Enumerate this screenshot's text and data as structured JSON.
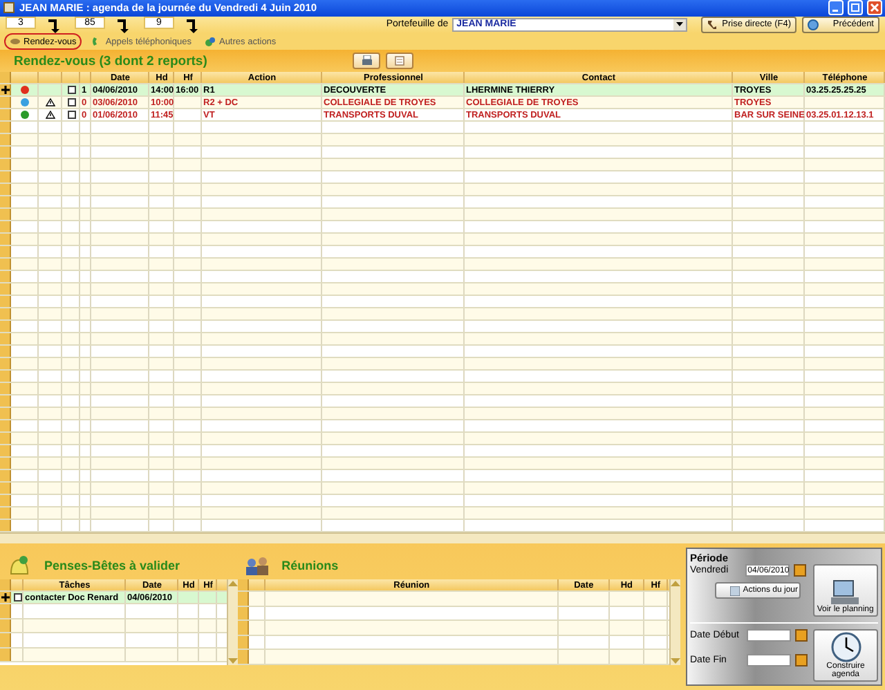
{
  "window": {
    "title": "JEAN MARIE : agenda de la journée du Vendredi 4 Juin 2010"
  },
  "counters": [
    {
      "value": "3"
    },
    {
      "value": "85"
    },
    {
      "value": "9"
    }
  ],
  "tabs": [
    {
      "label": "Rendez-vous",
      "selected": true
    },
    {
      "label": "Appels téléphoniques",
      "selected": false
    },
    {
      "label": "Autres actions",
      "selected": false
    }
  ],
  "portfolio": {
    "label": "Portefeuille de",
    "value": "JEAN MARIE"
  },
  "buttons": [
    {
      "kind": "direct",
      "label": "Prise directe (F4)"
    },
    {
      "kind": "back",
      "label": "Précédent"
    }
  ],
  "appointments": {
    "title": "Rendez-vous (3 dont 2 reports)",
    "columns": [
      "Date",
      "Hd",
      "Hf",
      "Action",
      "Professionnel",
      "Contact",
      "Ville",
      "Téléphone"
    ],
    "rows": [
      {
        "selected": true,
        "postponed": false,
        "color": "#e0301e",
        "warning": false,
        "checked": false,
        "count": "1",
        "date": "04/06/2010",
        "hd": "14:00",
        "hf": "16:00",
        "action": "R1",
        "professional": "DECOUVERTE",
        "contact": "LHERMINE THIERRY",
        "city": "TROYES",
        "phone": "03.25.25.25.25"
      },
      {
        "selected": false,
        "postponed": true,
        "color": "#3aa0e0",
        "warning": true,
        "checked": false,
        "count": "0",
        "date": "03/06/2010",
        "hd": "10:00",
        "action": "R2 + DC",
        "professional": "COLLEGIALE DE TROYES",
        "contact": "COLLEGIALE DE TROYES",
        "city": "TROYES"
      },
      {
        "selected": false,
        "postponed": true,
        "color": "#2a9a2a",
        "warning": true,
        "checked": false,
        "count": "0",
        "date": "01/06/2010",
        "hd": "11:45",
        "action": "VT",
        "professional": "TRANSPORTS DUVAL",
        "contact": "TRANSPORTS DUVAL",
        "city": "BAR SUR SEINE",
        "phone": "03.25.01.12.13.1"
      }
    ]
  },
  "reminders": {
    "title": "Penses-Bêtes à valider",
    "columns": [
      "Tâches",
      "Date",
      "Hd",
      "Hf"
    ],
    "rows": [
      {
        "selected": true,
        "checked": false,
        "task": "contacter Doc Renard",
        "date": "04/06/2010"
      }
    ]
  },
  "meetings": {
    "title": "Réunions",
    "columns": [
      "Réunion",
      "Date",
      "Hd",
      "Hf"
    ]
  },
  "period": {
    "title": "Période",
    "day": "Vendredi",
    "date": "04/06/2010",
    "actions_button": "Actions du jour",
    "planning_button": "Voir le planning",
    "start_label": "Date Début",
    "end_label": "Date Fin",
    "build_button": "Construire agenda"
  }
}
